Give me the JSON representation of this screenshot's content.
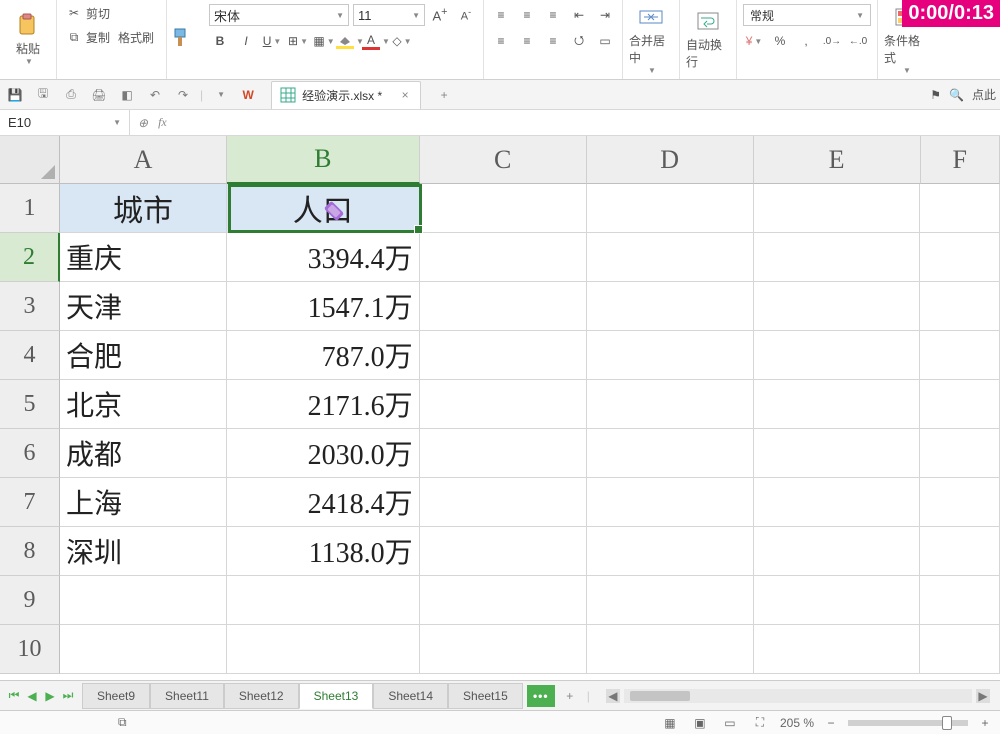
{
  "timer": "0:00/0:13",
  "ribbon": {
    "paste": "粘贴",
    "cut": "剪切",
    "copy": "复制",
    "format_painter": "格式刷",
    "font_name": "宋体",
    "font_size": "11",
    "bold": "B",
    "italic": "I",
    "underline": "U",
    "merge_center": "合并居中",
    "wrap_text": "自动换行",
    "number_format": "常规",
    "cond_format": "条件格式"
  },
  "qat": {
    "click_here": "点此"
  },
  "doc_tab": {
    "name": "经验演示.xlsx *"
  },
  "name_box": "E10",
  "columns": [
    "A",
    "B",
    "C",
    "D",
    "E",
    "F"
  ],
  "row_numbers": [
    1,
    2,
    3,
    4,
    5,
    6,
    7,
    8,
    9,
    10
  ],
  "header_row": {
    "A": "城市",
    "B": "人口"
  },
  "chart_data": {
    "type": "table",
    "columns": [
      "城市",
      "人口"
    ],
    "rows": [
      {
        "city": "重庆",
        "pop": "3394.4万"
      },
      {
        "city": "天津",
        "pop": "1547.1万"
      },
      {
        "city": "合肥",
        "pop": "787.0万"
      },
      {
        "city": "北京",
        "pop": "2171.6万"
      },
      {
        "city": "成都",
        "pop": "2030.0万"
      },
      {
        "city": "上海",
        "pop": "2418.4万"
      },
      {
        "city": "深圳",
        "pop": "1138.0万"
      }
    ]
  },
  "sheets": {
    "tabs": [
      "Sheet9",
      "Sheet11",
      "Sheet12",
      "Sheet13",
      "Sheet14",
      "Sheet15"
    ],
    "active": "Sheet13"
  },
  "status": {
    "zoom": "205 %"
  }
}
